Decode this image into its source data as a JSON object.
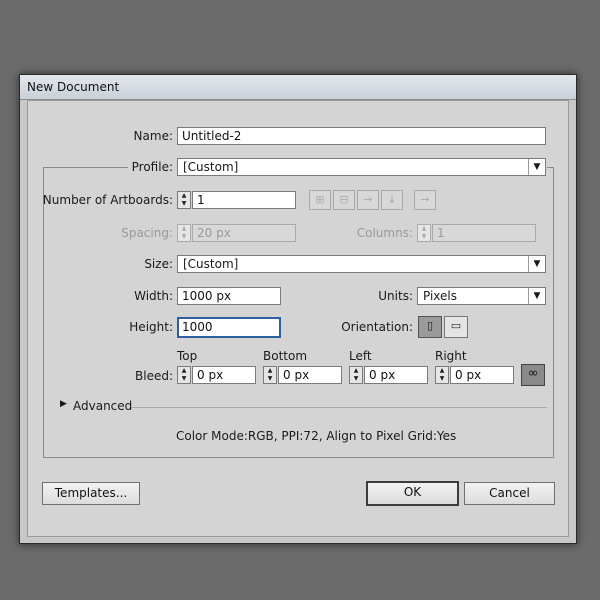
{
  "dialog": {
    "title": "New Document",
    "name_label": "Name:",
    "name_value": "Untitled-2",
    "profile_label": "Profile:",
    "profile_value": "[Custom]",
    "artboards_label": "Number of Artboards:",
    "artboards_value": "1",
    "spacing_label": "Spacing:",
    "spacing_value": "20 px",
    "columns_label": "Columns:",
    "columns_value": "1",
    "size_label": "Size:",
    "size_value": "[Custom]",
    "width_label": "Width:",
    "width_value": "1000 px",
    "units_label": "Units:",
    "units_value": "Pixels",
    "height_label": "Height:",
    "height_value": "1000",
    "orientation_label": "Orientation:",
    "bleed_label": "Bleed:",
    "bleed": {
      "top_label": "Top",
      "top_value": "0 px",
      "bottom_label": "Bottom",
      "bottom_value": "0 px",
      "left_label": "Left",
      "left_value": "0 px",
      "right_label": "Right",
      "right_value": "0 px"
    },
    "advanced_label": "Advanced",
    "summary": "Color Mode:RGB, PPI:72, Align to Pixel Grid:Yes",
    "templates_button": "Templates...",
    "ok_button": "OK",
    "cancel_button": "Cancel"
  },
  "icons": {
    "spinner": "up-down-arrows",
    "dropdown": "triangle-down",
    "arrange_buttons": [
      "grid-by-row-icon",
      "grid-by-column-icon",
      "arrange-by-row-icon",
      "arrange-by-column-icon",
      "right-to-left-icon"
    ],
    "orientation_buttons": [
      "portrait-icon",
      "landscape-icon"
    ],
    "bleed_link": "link-icon",
    "disclosure": "triangle-right"
  }
}
